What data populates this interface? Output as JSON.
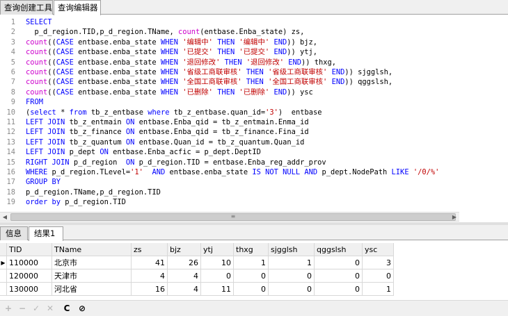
{
  "tabs": [
    {
      "label": "查询创建工具"
    },
    {
      "label": "查询编辑器"
    }
  ],
  "editor": {
    "lines": [
      {
        "n": "1",
        "parts": [
          [
            "kw",
            "SELECT"
          ]
        ]
      },
      {
        "n": "2",
        "parts": [
          [
            "",
            "  p_d_region.TID,p_d_region.TName, "
          ],
          [
            "fn",
            "count"
          ],
          [
            "",
            "(entbase.Enba_state) zs,"
          ]
        ]
      },
      {
        "n": "3",
        "parts": [
          [
            "fn",
            "count"
          ],
          [
            "",
            "(("
          ],
          [
            "kw",
            "CASE"
          ],
          [
            "",
            " entbase.enba_state "
          ],
          [
            "kw",
            "WHEN"
          ],
          [
            "",
            " "
          ],
          [
            "str",
            "'编辑中'"
          ],
          [
            "",
            " "
          ],
          [
            "kw",
            "THEN"
          ],
          [
            "",
            " "
          ],
          [
            "str",
            "'编辑中'"
          ],
          [
            "",
            " "
          ],
          [
            "kw",
            "END"
          ],
          [
            "",
            ")) bjz,"
          ]
        ]
      },
      {
        "n": "4",
        "parts": [
          [
            "fn",
            "count"
          ],
          [
            "",
            "(("
          ],
          [
            "kw",
            "CASE"
          ],
          [
            "",
            " entbase.enba_state "
          ],
          [
            "kw",
            "WHEN"
          ],
          [
            "",
            " "
          ],
          [
            "str",
            "'已提交'"
          ],
          [
            "",
            " "
          ],
          [
            "kw",
            "THEN"
          ],
          [
            "",
            " "
          ],
          [
            "str",
            "'已提交'"
          ],
          [
            "",
            " "
          ],
          [
            "kw",
            "END"
          ],
          [
            "",
            ")) ytj,"
          ]
        ]
      },
      {
        "n": "5",
        "parts": [
          [
            "fn",
            "count"
          ],
          [
            "",
            "(("
          ],
          [
            "kw",
            "CASE"
          ],
          [
            "",
            " entbase.enba_state "
          ],
          [
            "kw",
            "WHEN"
          ],
          [
            "",
            " "
          ],
          [
            "str",
            "'退回修改'"
          ],
          [
            "",
            " "
          ],
          [
            "kw",
            "THEN"
          ],
          [
            "",
            " "
          ],
          [
            "str",
            "'退回修改'"
          ],
          [
            "",
            " "
          ],
          [
            "kw",
            "END"
          ],
          [
            "",
            ")) thxg,"
          ]
        ]
      },
      {
        "n": "6",
        "parts": [
          [
            "fn",
            "count"
          ],
          [
            "",
            "(("
          ],
          [
            "kw",
            "CASE"
          ],
          [
            "",
            " entbase.enba_state "
          ],
          [
            "kw",
            "WHEN"
          ],
          [
            "",
            " "
          ],
          [
            "str",
            "'省级工商联审核'"
          ],
          [
            "",
            " "
          ],
          [
            "kw",
            "THEN"
          ],
          [
            "",
            " "
          ],
          [
            "str",
            "'省级工商联审核'"
          ],
          [
            "",
            " "
          ],
          [
            "kw",
            "END"
          ],
          [
            "",
            ")) sjgglsh,"
          ]
        ]
      },
      {
        "n": "7",
        "parts": [
          [
            "fn",
            "count"
          ],
          [
            "",
            "(("
          ],
          [
            "kw",
            "CASE"
          ],
          [
            "",
            " entbase.enba_state "
          ],
          [
            "kw",
            "WHEN"
          ],
          [
            "",
            " "
          ],
          [
            "str",
            "'全国工商联审核'"
          ],
          [
            "",
            " "
          ],
          [
            "kw",
            "THEN"
          ],
          [
            "",
            " "
          ],
          [
            "str",
            "'全国工商联审核'"
          ],
          [
            "",
            " "
          ],
          [
            "kw",
            "END"
          ],
          [
            "",
            ")) qggslsh,"
          ]
        ]
      },
      {
        "n": "8",
        "parts": [
          [
            "fn",
            "count"
          ],
          [
            "",
            "(("
          ],
          [
            "kw",
            "CASE"
          ],
          [
            "",
            " entbase.enba_state "
          ],
          [
            "kw",
            "WHEN"
          ],
          [
            "",
            " "
          ],
          [
            "str",
            "'已删除'"
          ],
          [
            "",
            " "
          ],
          [
            "kw",
            "THEN"
          ],
          [
            "",
            " "
          ],
          [
            "str",
            "'已删除'"
          ],
          [
            "",
            " "
          ],
          [
            "kw",
            "END"
          ],
          [
            "",
            ")) ysc"
          ]
        ]
      },
      {
        "n": "9",
        "parts": [
          [
            "kw",
            "FROM"
          ]
        ]
      },
      {
        "n": "10",
        "parts": [
          [
            "",
            "("
          ],
          [
            "kw",
            "select"
          ],
          [
            "",
            " * "
          ],
          [
            "kw",
            "from"
          ],
          [
            "",
            " tb_z_entbase "
          ],
          [
            "kw",
            "where"
          ],
          [
            "",
            " tb_z_entbase.quan_id="
          ],
          [
            "str",
            "'3'"
          ],
          [
            "",
            ")  entbase"
          ]
        ]
      },
      {
        "n": "11",
        "parts": [
          [
            "kw",
            "LEFT JOIN"
          ],
          [
            "",
            " tb_z_entmain "
          ],
          [
            "kw",
            "ON"
          ],
          [
            "",
            " entbase.Enba_qid = tb_z_entmain.Enma_id"
          ]
        ]
      },
      {
        "n": "12",
        "parts": [
          [
            "kw",
            "LEFT JOIN"
          ],
          [
            "",
            " tb_z_finance "
          ],
          [
            "kw",
            "ON"
          ],
          [
            "",
            " entbase.Enba_qid = tb_z_finance.Fina_id"
          ]
        ]
      },
      {
        "n": "13",
        "parts": [
          [
            "kw",
            "LEFT JOIN"
          ],
          [
            "",
            " tb_z_quantum "
          ],
          [
            "kw",
            "ON"
          ],
          [
            "",
            " entbase.Quan_id = tb_z_quantum.Quan_id"
          ]
        ]
      },
      {
        "n": "14",
        "parts": [
          [
            "kw",
            "LEFT JOIN"
          ],
          [
            "",
            " p_dept "
          ],
          [
            "kw",
            "ON"
          ],
          [
            "",
            " entbase.Enba_acfic = p_dept.DeptID"
          ]
        ]
      },
      {
        "n": "15",
        "parts": [
          [
            "kw",
            "RIGHT JOIN"
          ],
          [
            "",
            " p_d_region  "
          ],
          [
            "kw",
            "ON"
          ],
          [
            "",
            " p_d_region.TID = entbase.Enba_reg_addr_prov"
          ]
        ]
      },
      {
        "n": "16",
        "parts": [
          [
            "kw",
            "WHERE"
          ],
          [
            "",
            " p_d_region.TLevel="
          ],
          [
            "str",
            "'1'"
          ],
          [
            "",
            "  "
          ],
          [
            "kw",
            "AND"
          ],
          [
            "",
            " entbase.enba_state "
          ],
          [
            "kw",
            "IS NOT NULL AND"
          ],
          [
            "",
            " p_dept.NodePath "
          ],
          [
            "kw",
            "LIKE"
          ],
          [
            "",
            " "
          ],
          [
            "str",
            "'/0/%'"
          ]
        ]
      },
      {
        "n": "17",
        "parts": [
          [
            "kw",
            "GROUP BY"
          ]
        ]
      },
      {
        "n": "18",
        "parts": [
          [
            "",
            "p_d_region.TName,p_d_region.TID"
          ]
        ]
      },
      {
        "n": "19",
        "parts": [
          [
            "kw",
            "order by"
          ],
          [
            "",
            " p_d_region.TID"
          ]
        ]
      }
    ]
  },
  "scrollbar": {
    "left_arrow": "◀",
    "right_arrow": "▶",
    "grip": "≡"
  },
  "result_tabs": [
    {
      "label": "信息"
    },
    {
      "label": "结果1"
    }
  ],
  "grid": {
    "columns": [
      "TID",
      "TName",
      "zs",
      "bjz",
      "ytj",
      "thxg",
      "sjgglsh",
      "qggslsh",
      "ysc"
    ],
    "rows": [
      [
        "110000",
        "北京市",
        "41",
        "26",
        "10",
        "1",
        "1",
        "0",
        "3"
      ],
      [
        "120000",
        "天津市",
        "4",
        "4",
        "0",
        "0",
        "0",
        "0",
        "0"
      ],
      [
        "130000",
        "河北省",
        "16",
        "4",
        "11",
        "0",
        "0",
        "0",
        "1"
      ]
    ],
    "current_row_marker": "▶"
  },
  "toolbar": {
    "add": "+",
    "remove": "−",
    "apply": "✓",
    "discard": "✕",
    "refresh": "C",
    "stop": "⊘"
  },
  "colors": {
    "keyword": "#0000ff",
    "string": "#c00000",
    "function": "#cc00cc",
    "line_number": "#8a8a8a"
  }
}
